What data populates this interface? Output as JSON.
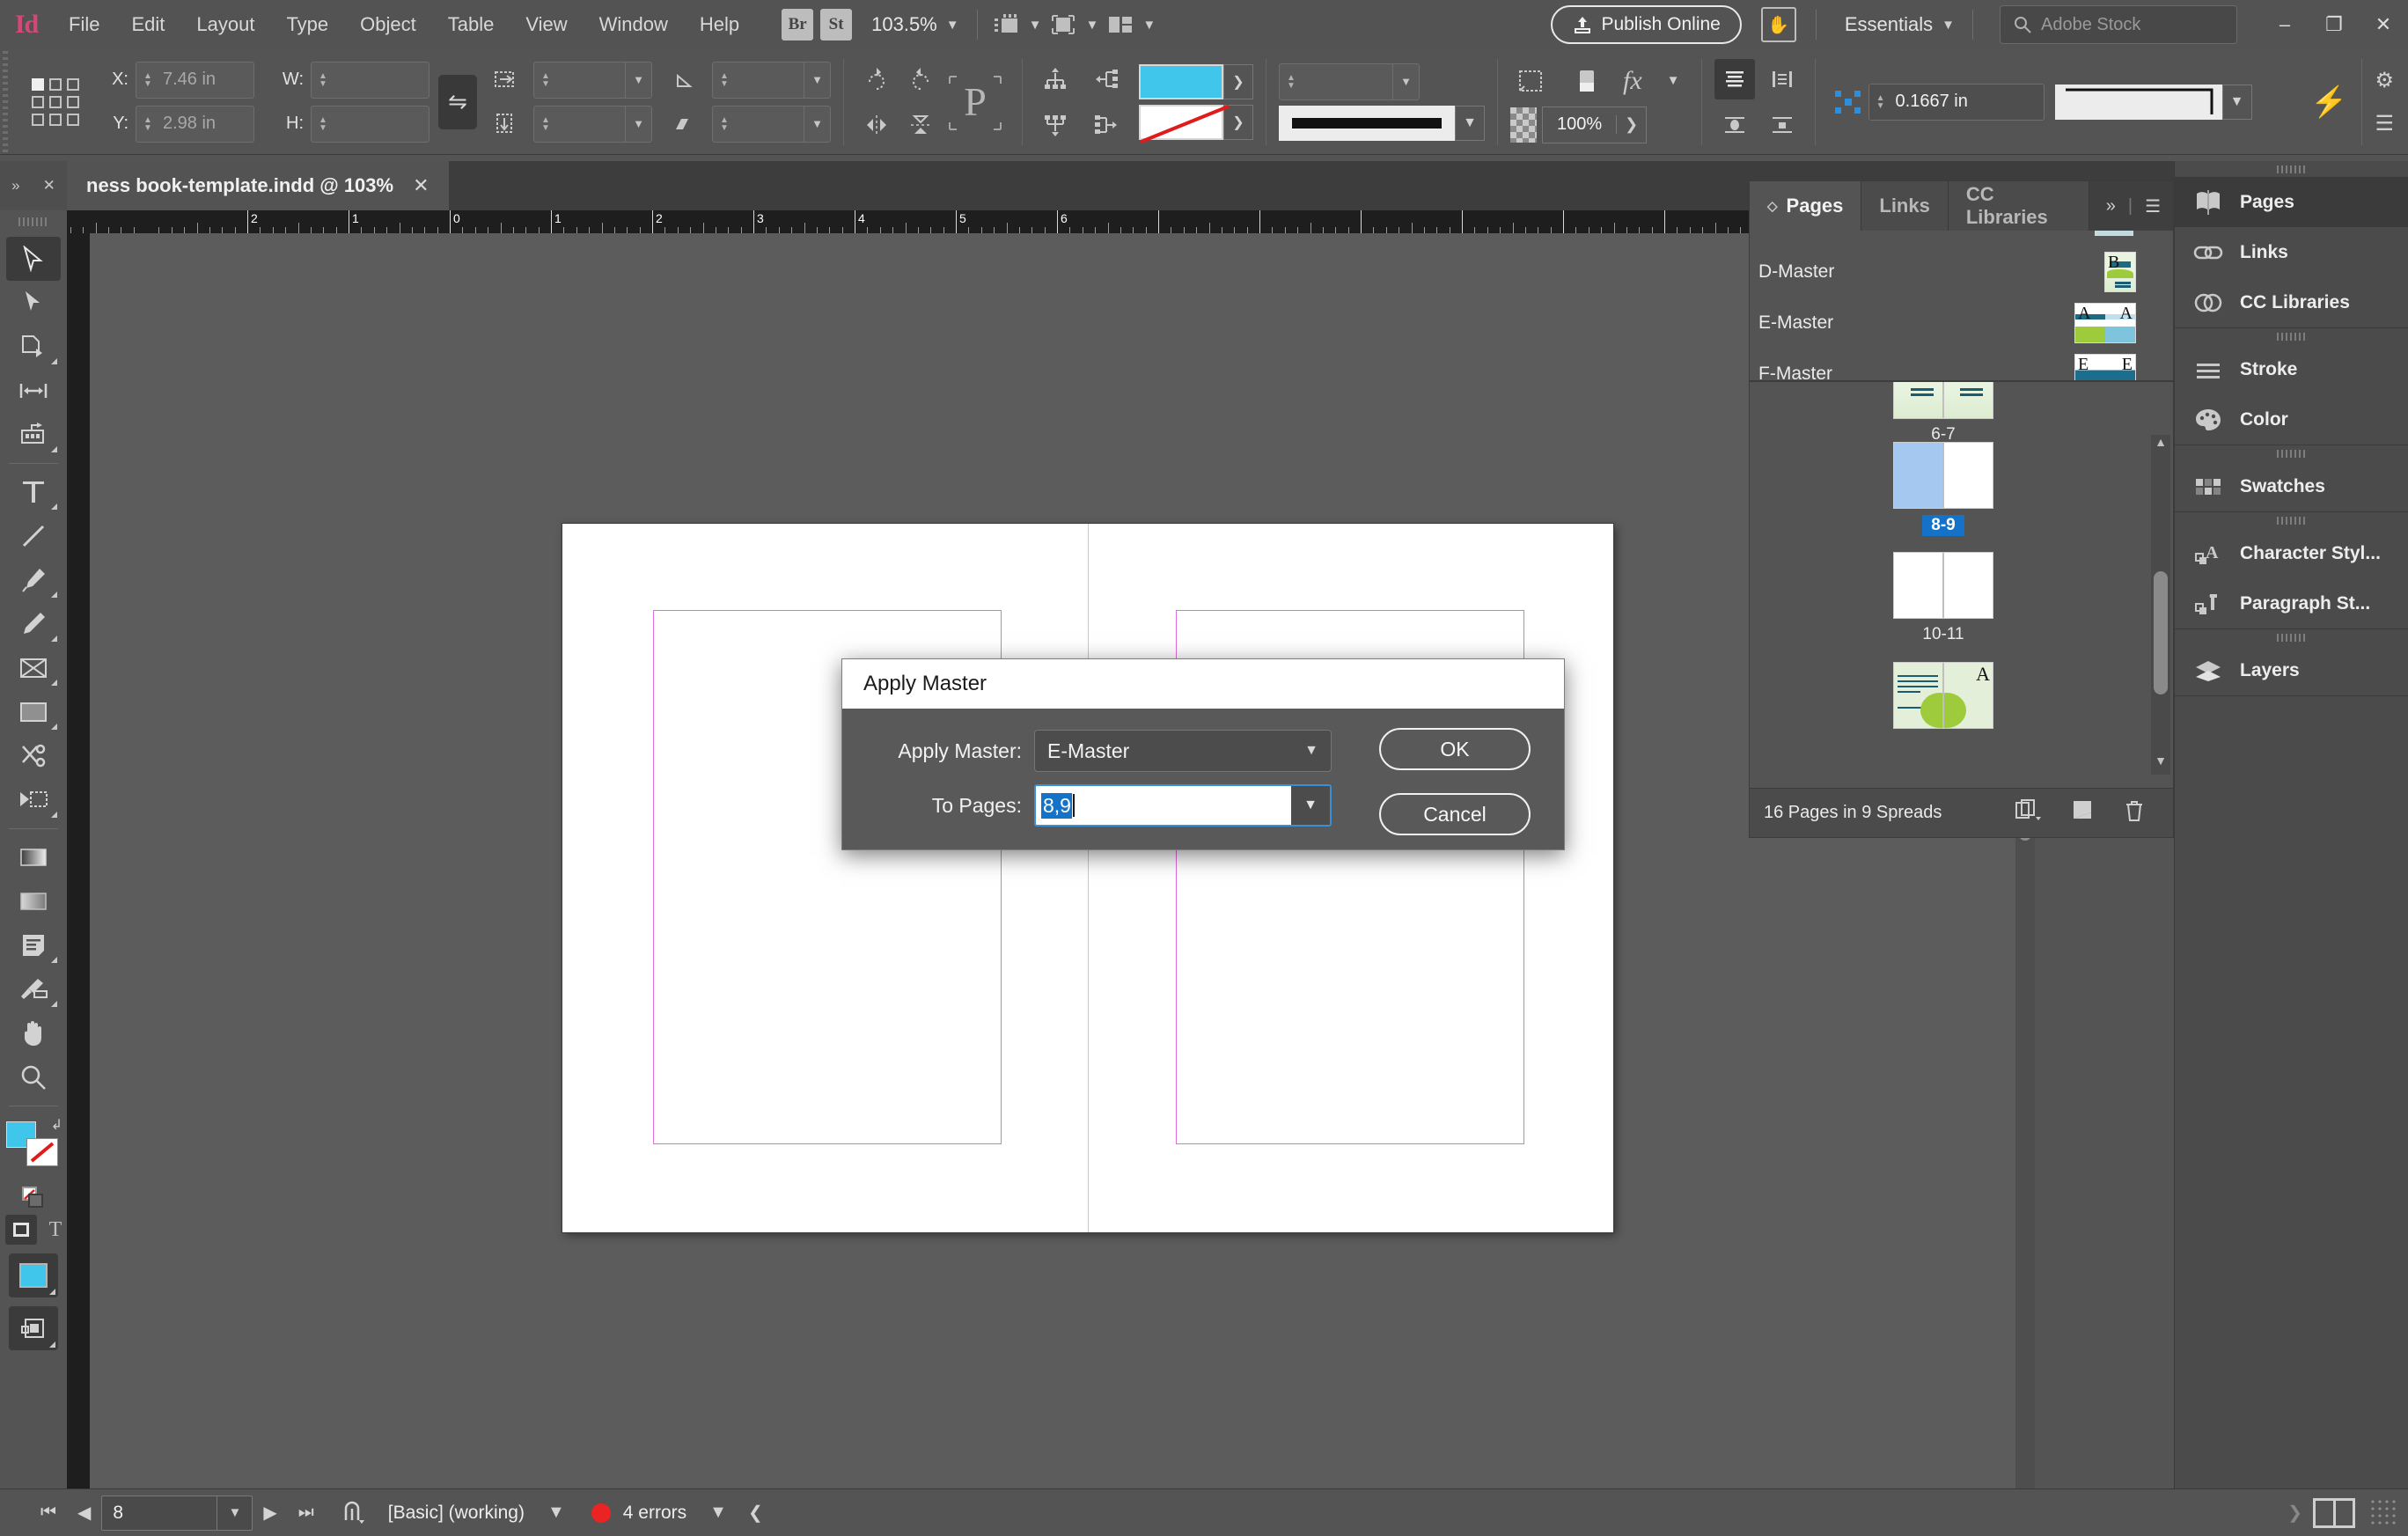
{
  "app": {
    "logo": "Id",
    "menus": [
      "File",
      "Edit",
      "Layout",
      "Type",
      "Object",
      "Table",
      "View",
      "Window",
      "Help"
    ],
    "bridge_label": "Br",
    "stock_label": "St",
    "zoom_level": "103.5%",
    "publish_label": "Publish Online",
    "workspace": "Essentials",
    "stock_placeholder": "Adobe Stock",
    "window_buttons": {
      "minimize": "–",
      "restore": "❐",
      "close": "✕"
    }
  },
  "control_bar": {
    "x_label": "X:",
    "x_value": "7.46 in",
    "y_label": "Y:",
    "y_value": "2.98 in",
    "w_label": "W:",
    "w_value": "",
    "h_label": "H:",
    "h_value": "",
    "scale_x_value": "",
    "scale_y_value": "",
    "rotate_value": "",
    "shear_value": "",
    "opacity_value": "100%",
    "gap_value": "0.1667 in",
    "stroke_weight": "",
    "p_marker": "P"
  },
  "tab": {
    "title": "ness book-template.indd @ 103%",
    "close": "✕",
    "collapse": "»",
    "tool_close": "✕"
  },
  "ruler": {
    "unit": "in",
    "labels": [
      "2",
      "1",
      "0",
      "1",
      "2",
      "3",
      "4",
      "5",
      "6"
    ]
  },
  "tools": [
    {
      "name": "selection-tool",
      "glyph": "selection",
      "selected": true
    },
    {
      "name": "direct-selection-tool",
      "glyph": "direct",
      "selected": false
    },
    {
      "name": "page-tool",
      "glyph": "page",
      "selected": false
    },
    {
      "name": "gap-tool",
      "glyph": "gap",
      "selected": false
    },
    {
      "name": "content-collector-tool",
      "glyph": "collector",
      "selected": false
    },
    {
      "name": "type-tool",
      "glyph": "type",
      "selected": false
    },
    {
      "name": "line-tool",
      "glyph": "line",
      "selected": false
    },
    {
      "name": "pen-tool",
      "glyph": "pen",
      "selected": false
    },
    {
      "name": "pencil-tool",
      "glyph": "pencil",
      "selected": false
    },
    {
      "name": "frame-tool",
      "glyph": "frame",
      "selected": false
    },
    {
      "name": "rectangle-tool",
      "glyph": "rect",
      "selected": false
    },
    {
      "name": "scissors-tool",
      "glyph": "scissors",
      "selected": false
    },
    {
      "name": "free-transform-tool",
      "glyph": "transform",
      "selected": false
    },
    {
      "name": "gradient-swatch-tool",
      "glyph": "gradient",
      "selected": false
    },
    {
      "name": "gradient-feather-tool",
      "glyph": "feather",
      "selected": false
    },
    {
      "name": "note-tool",
      "glyph": "note",
      "selected": false
    },
    {
      "name": "eyedropper-tool",
      "glyph": "eyedropper",
      "selected": false
    },
    {
      "name": "hand-tool",
      "glyph": "hand",
      "selected": false
    },
    {
      "name": "zoom-tool",
      "glyph": "zoom",
      "selected": false
    }
  ],
  "dialog": {
    "title": "Apply Master",
    "apply_master_label": "Apply Master:",
    "apply_master_value": "E-Master",
    "to_pages_label": "To Pages:",
    "to_pages_value": "8,9",
    "ok_label": "OK",
    "cancel_label": "Cancel",
    "accent_focus": "#3b8fd4",
    "selection_color": "#1473c8"
  },
  "pages_panel": {
    "tabs": [
      {
        "label": "Pages",
        "active": true
      },
      {
        "label": "Links",
        "active": false
      },
      {
        "label": "CC Libraries",
        "active": false
      }
    ],
    "overflow": "»",
    "menu": "☰",
    "masters": [
      {
        "label": "D-Master",
        "letters": [
          "B"
        ],
        "kind": "single"
      },
      {
        "label": "E-Master",
        "letters": [
          "A",
          "A"
        ],
        "kind": "spread"
      },
      {
        "label": "F-Master",
        "letters": [
          "E",
          "E"
        ],
        "kind": "spread"
      }
    ],
    "spreads": [
      {
        "label": "6-7",
        "selected": false,
        "kind": "art",
        "pages": 2
      },
      {
        "label": "8-9",
        "selected": true,
        "kind": "blue-left",
        "pages": 2
      },
      {
        "label": "10-11",
        "selected": false,
        "kind": "blank",
        "pages": 2
      },
      {
        "label": "",
        "selected": false,
        "kind": "quote",
        "pages": 2
      }
    ],
    "footer_count": "16 Pages in 9 Spreads",
    "footer_actions": [
      "new-master-icon",
      "new-page-icon",
      "delete-page-icon"
    ]
  },
  "dock": {
    "groups": [
      [
        {
          "label": "Pages",
          "icon": "pages-icon",
          "active": true
        },
        {
          "label": "Links",
          "icon": "links-icon",
          "active": false
        },
        {
          "label": "CC Libraries",
          "icon": "cc-libraries-icon",
          "active": false
        }
      ],
      [
        {
          "label": "Stroke",
          "icon": "stroke-icon",
          "active": false
        },
        {
          "label": "Color",
          "icon": "color-icon",
          "active": false
        }
      ],
      [
        {
          "label": "Swatches",
          "icon": "swatches-icon",
          "active": false
        }
      ],
      [
        {
          "label": "Character Styl...",
          "icon": "character-styles-icon",
          "active": false
        },
        {
          "label": "Paragraph St...",
          "icon": "paragraph-styles-icon",
          "active": false
        }
      ],
      [
        {
          "label": "Layers",
          "icon": "layers-icon",
          "active": false
        }
      ]
    ]
  },
  "status_bar": {
    "page_value": "8",
    "preflight_profile": "[Basic] (working)",
    "errors": "4 errors",
    "first": "⏮",
    "prev": "◀",
    "next": "▶",
    "last": "⏭"
  }
}
